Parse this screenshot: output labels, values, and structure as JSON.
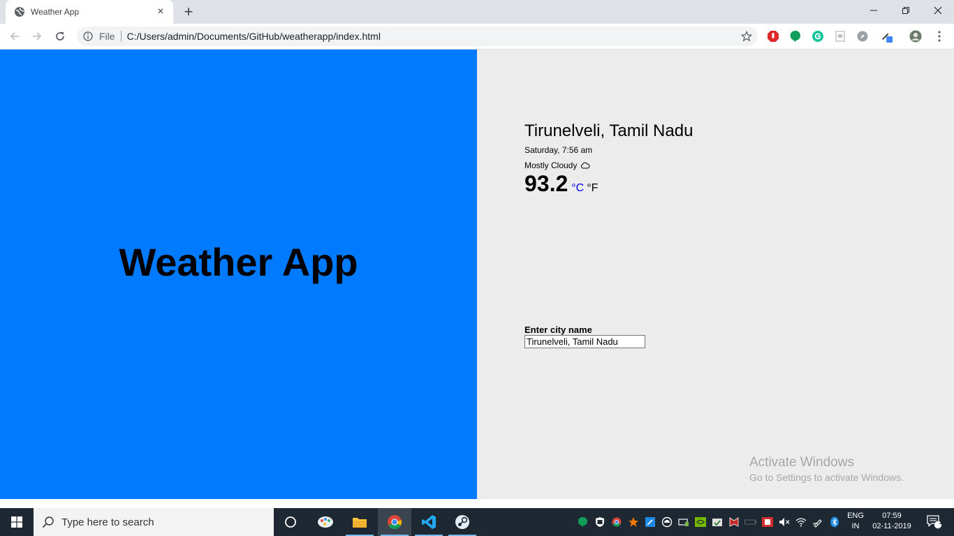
{
  "browser": {
    "tab": {
      "title": "Weather App"
    },
    "address": {
      "scheme_label": "File",
      "url": "C:/Users/admin/Documents/GitHub/weatherapp/index.html"
    }
  },
  "page": {
    "app_title": "Weather App",
    "location": "Tirunelveli, Tamil Nadu",
    "datetime": "Saturday, 7:56 am",
    "condition": "Mostly Cloudy",
    "temperature": "93.2",
    "unit_c": "°C",
    "unit_f": "°F",
    "city_label": "Enter city name",
    "city_input_value": "Tirunelveli, Tamil Nadu",
    "watermark_title": "Activate Windows",
    "watermark_subtitle": "Go to Settings to activate Windows."
  },
  "taskbar": {
    "search_placeholder": "Type here to search",
    "apps": [
      "cortana-icon",
      "paint-icon",
      "file-explorer-icon",
      "chrome-icon",
      "vscode-icon",
      "steam-icon"
    ],
    "lang_top": "ENG",
    "lang_bottom": "IN",
    "time": "07:59",
    "date": "02-11-2019",
    "notification_count": "1"
  },
  "colors": {
    "left_panel": "#007bff",
    "right_panel": "#ececec",
    "celsius_link": "#0000ee",
    "taskbar": "#1e2833"
  }
}
